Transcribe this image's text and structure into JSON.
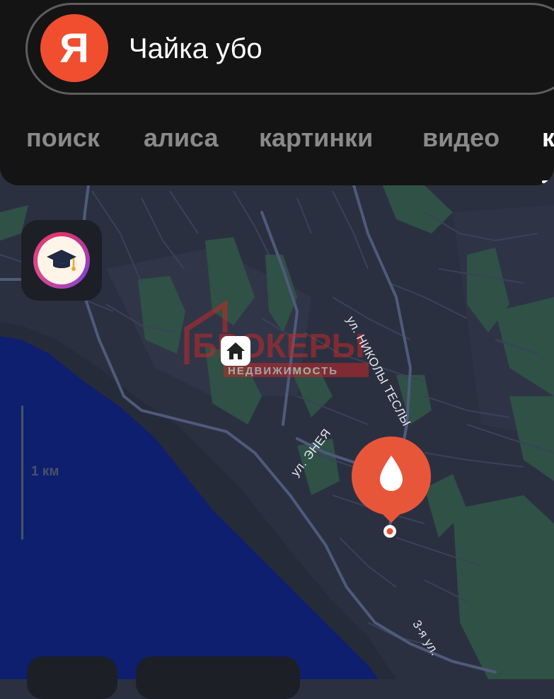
{
  "search": {
    "query": "Чайка убо",
    "logo_letter": "Я"
  },
  "tabs": [
    {
      "label": "поиск"
    },
    {
      "label": "алиса"
    },
    {
      "label": "картинки"
    },
    {
      "label": "видео"
    },
    {
      "label": "к"
    }
  ],
  "map": {
    "watermark_brand": "БРОКЕРЫ",
    "watermark_sub": "НЕДВИЖИМОСТЬ",
    "streets": {
      "tesla": "ул. НИКОЛЫ ТЕСЛЫ",
      "eneya": "ул. ЭНЕЯ",
      "third": "3-я ул."
    },
    "scale_label": "1 км"
  },
  "icons": {
    "logo": "yandex-logo-icon",
    "education": "graduation-cap-icon",
    "house": "house-icon",
    "pin": "water-drop-pin-icon"
  },
  "colors": {
    "accent": "#f04e2f",
    "sea": "#0d1f6e",
    "land": "#2b3040",
    "park": "#2f5146",
    "road": "#4f5a7c"
  }
}
